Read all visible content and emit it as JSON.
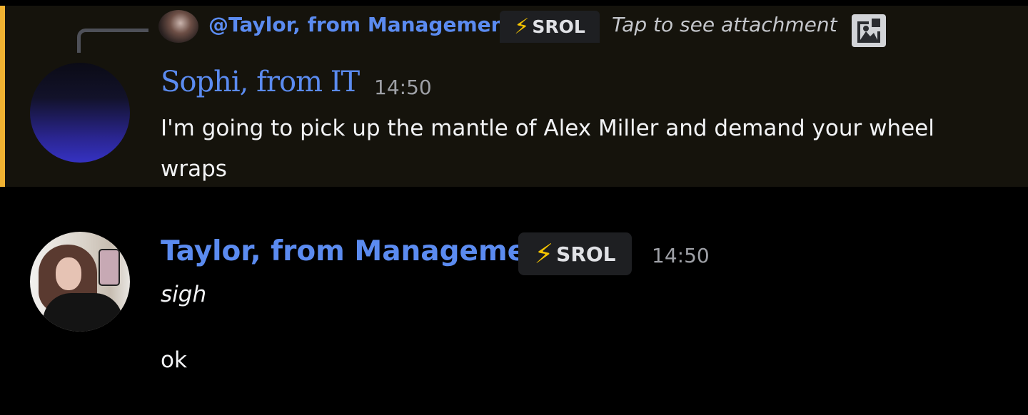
{
  "reply": {
    "mention": "@Taylor, from Management",
    "badge_emoji": "⚡",
    "badge": "SROL",
    "attachment_text": "Tap to see attachment",
    "attachment_icon": "image-icon"
  },
  "messages": [
    {
      "author": "Sophi, from IT",
      "time": "14:50",
      "content": "I'm going to pick up the mantle of Alex Miller and demand your wheel wraps"
    },
    {
      "author": "Taylor, from Management",
      "badge_emoji": "⚡",
      "badge": "SROL",
      "time": "14:50",
      "lines": [
        "sigh",
        "ok"
      ]
    }
  ],
  "colors": {
    "background": "#000000",
    "highlight": "#15130c",
    "mention_bar": "#f0b232",
    "name": "#5b8bf0",
    "timestamp": "#9ea0a6",
    "text": "#f2f3f5"
  }
}
